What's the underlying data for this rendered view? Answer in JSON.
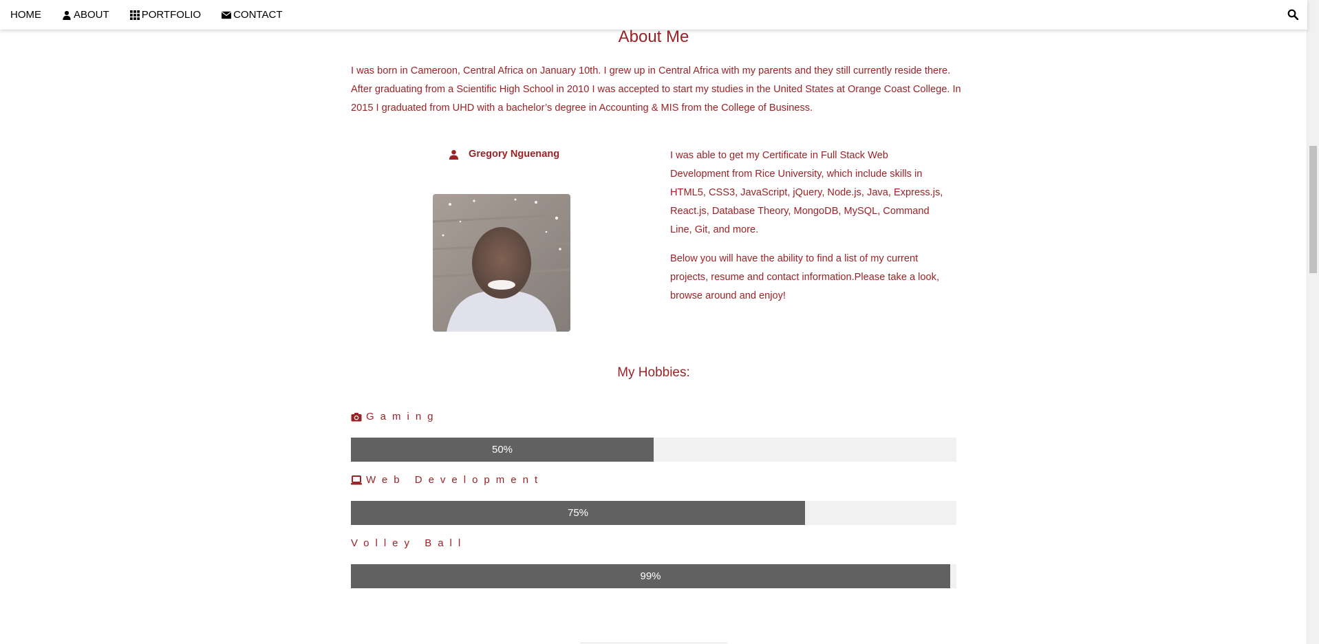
{
  "nav": {
    "items": [
      {
        "label": "HOME",
        "icon": null
      },
      {
        "label": "ABOUT",
        "icon": "user-icon"
      },
      {
        "label": "PORTFOLIO",
        "icon": "grid-icon"
      },
      {
        "label": "CONTACT",
        "icon": "envelope-icon"
      }
    ],
    "search_icon": "search-icon"
  },
  "about": {
    "title": "About Me",
    "intro": "I was born in Cameroon, Central Africa on January 10th. I grew up in Central Africa with my parents and they still currently reside there. After graduating from a Scientific High School in 2010 I was accepted to start my studies in the United States at Orange Coast College. In 2015 I graduated from UHD with a bachelor’s degree in Accounting & MIS from the College of Business.",
    "name": "Gregory Nguenang",
    "bio": [
      "I was able to get my Certificate in Full Stack Web Development from Rice University, which include skills in HTML5, CSS3, JavaScript, jQuery, Node.js, Java, Express.js, React.js, Database Theory, MongoDB, MySQL, Command Line, Git, and more.",
      "Below you will have the ability to find a list of my current projects, resume and contact information.Please take a look, browse around and enjoy!"
    ]
  },
  "hobbies": {
    "title": "My Hobbies:",
    "items": [
      {
        "label": "Gaming",
        "icon": "camera-icon",
        "percent_label": "50%",
        "percent": 50
      },
      {
        "label": "Web Development",
        "icon": "laptop-icon",
        "percent_label": "75%",
        "percent": 75
      },
      {
        "label": "Volley Ball",
        "icon": null,
        "percent_label": "99%",
        "percent": 99
      }
    ]
  },
  "colors": {
    "accent": "#9b2226",
    "bar_fill": "#616161",
    "bar_track": "#f1f1f1"
  }
}
